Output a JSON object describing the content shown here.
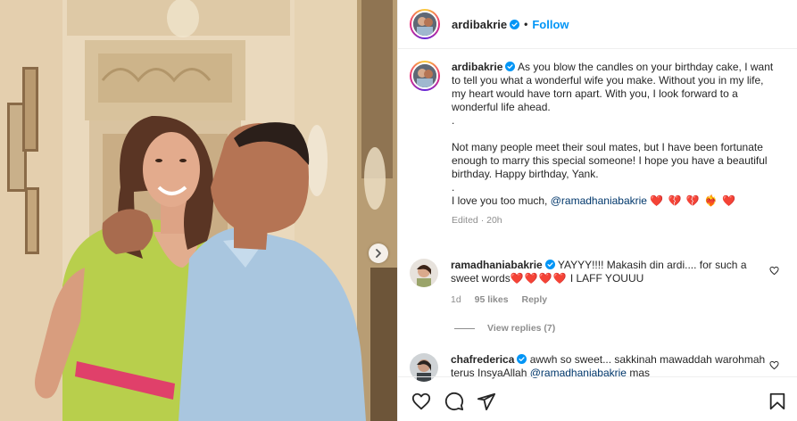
{
  "post": {
    "username": "ardibakrie",
    "follow_label": "Follow",
    "separator": "•",
    "caption_part1": "As you blow the candles on your birthday cake, I want to tell you what a wonderful wife you make. Without you in my life, my heart would have torn apart. With you, I look forward to a wonderful life ahead.",
    "caption_dot1": ".",
    "caption_part2": "Not many people meet their soul mates, but I have been fortunate enough to marry this special someone! I hope you have a beautiful birthday. Happy birthday, Yank.",
    "caption_dot2": ".",
    "caption_part3": "I love you too much,",
    "caption_mention": "@ramadhaniabakrie",
    "caption_hearts": "❤️ 💔 💔 ❤️‍🔥 ❤️",
    "edited": "Edited",
    "time": "20h"
  },
  "comments": [
    {
      "username": "ramadhaniabakrie",
      "text_before_hearts": "YAYYY!!!! Makasih din ardi.... for such a sweet words",
      "hearts": "❤️❤️❤️❤️",
      "text_after_hearts": "I LAFF YOUUU",
      "time": "1d",
      "likes": "95 likes",
      "reply_label": "Reply",
      "view_replies": "View replies (7)"
    },
    {
      "username": "chafrederica",
      "text": "awwh so sweet... sakkinah mawaddah warohmah terus InsyaAllah",
      "mention": "@ramadhaniabakrie",
      "text_after_mention": "mas"
    }
  ],
  "icons": {
    "verified": "verified-badge-icon",
    "like": "heart-outline-icon",
    "comment": "comment-icon",
    "share": "paper-plane-icon",
    "save": "bookmark-icon",
    "next": "chevron-right-icon"
  },
  "colors": {
    "accent": "#0095f6",
    "mention": "#00376b",
    "heart": "#e0263a",
    "muted": "#8e8e8e"
  }
}
